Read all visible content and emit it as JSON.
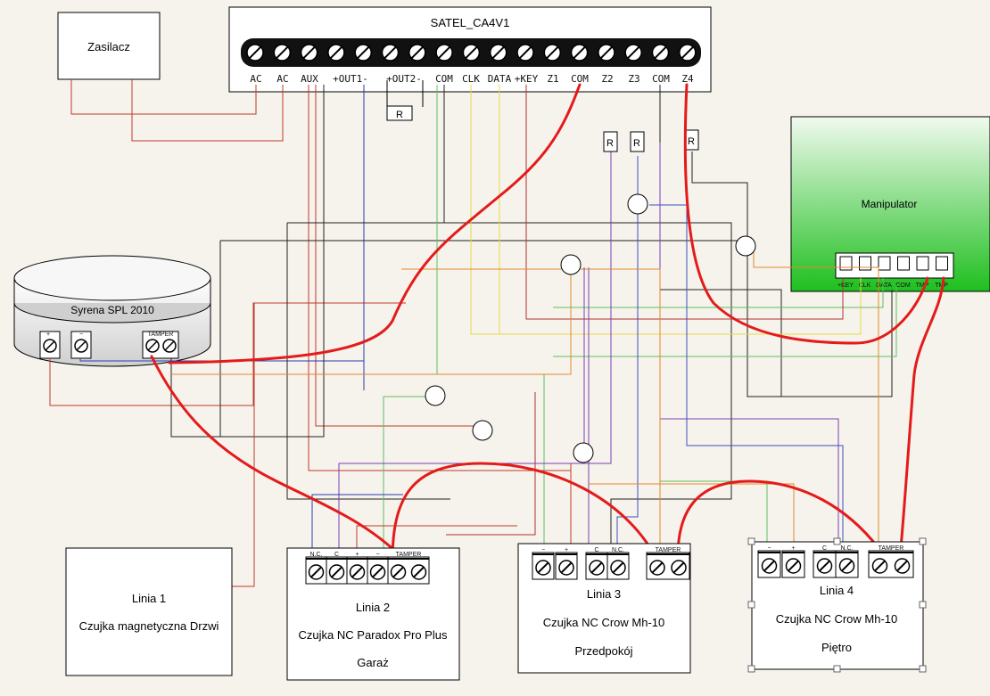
{
  "panel": {
    "title": "SATEL_CA4V1",
    "terminals": [
      "AC",
      "AC",
      "AUX",
      "+OUT1-",
      "+OUT2-",
      "COM",
      "CLK",
      "DATA",
      "+KEY",
      "Z1",
      "COM",
      "Z2",
      "Z3",
      "COM",
      "Z4"
    ],
    "resistor_label": "R"
  },
  "power_supply": {
    "label": "Zasilacz"
  },
  "keypad": {
    "label": "Manipulator",
    "terminals": [
      "+KEY",
      "CLK",
      "DATA",
      "COM",
      "TMP",
      "TMP"
    ],
    "gradient": [
      "#e9f7e6",
      "#2fbf2f"
    ]
  },
  "siren": {
    "label": "Syrena SPL 2010",
    "plus": "+",
    "minus": "−",
    "tamper": "TAMPER"
  },
  "line1": {
    "title": "Linia 1",
    "desc": "Czujka magnetyczna Drzwi"
  },
  "line2": {
    "title": "Linia 2",
    "desc": "Czujka NC Paradox Pro Plus",
    "place": "Garaż",
    "terminals": [
      "N.C.",
      "C",
      "+",
      "−",
      "TAMPER"
    ]
  },
  "line3": {
    "title": "Linia 3",
    "desc": "Czujka NC Crow Mh-10",
    "place": "Przedpokój",
    "terminals": [
      "−",
      "+",
      "C",
      "N.C.",
      "TAMPER"
    ]
  },
  "line4": {
    "title": "Linia 4",
    "desc": "Czujka NC Crow Mh-10",
    "place": "Piętro",
    "terminals": [
      "−",
      "+",
      "C",
      "N.C.",
      "TAMPER"
    ]
  },
  "colors": {
    "tamper_loop": "#e31b1b",
    "power": "#c0392b",
    "negative": "#2a3bb5",
    "ground": "#222222",
    "clk": "#e6d94a",
    "data": "#5fbf5f",
    "key": "#b03030",
    "z2": "#7b3fb5",
    "z3": "#3a4fc0",
    "z4": "#e08a2a"
  }
}
